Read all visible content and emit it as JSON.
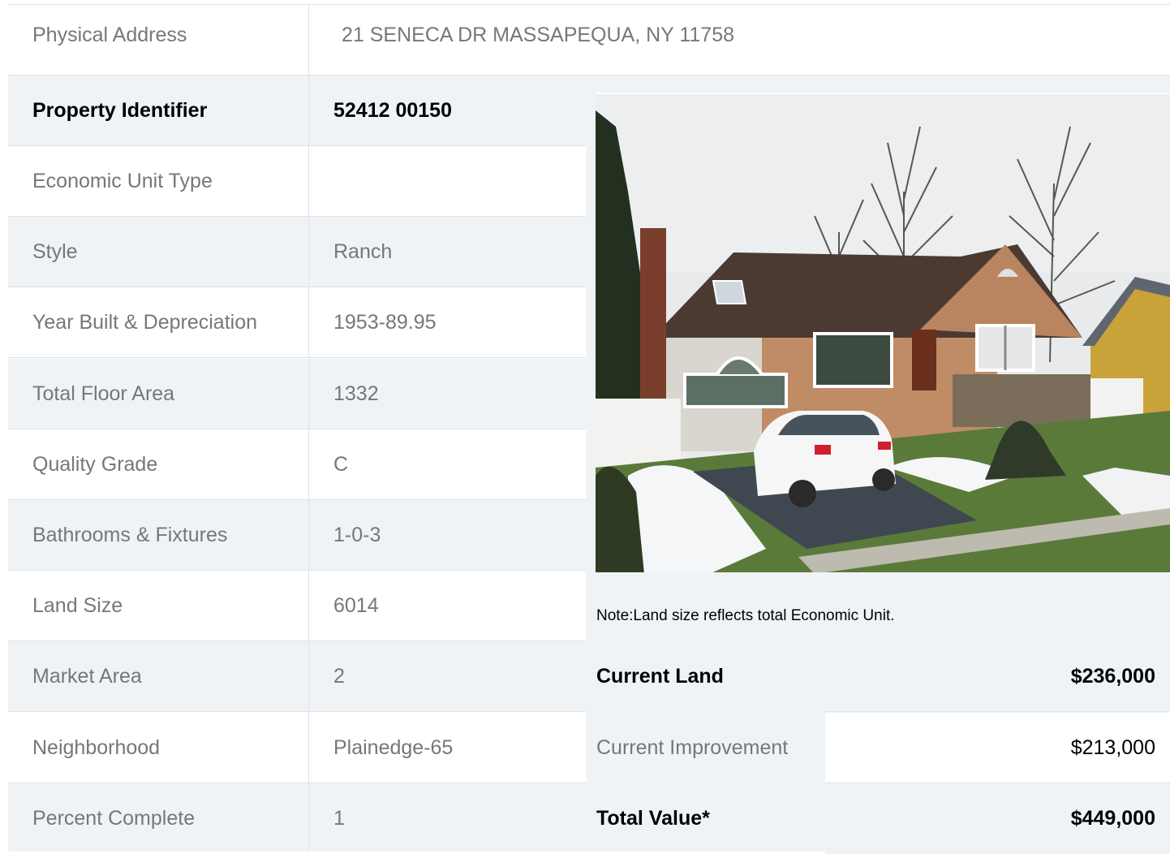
{
  "address": {
    "label": "Physical Address",
    "value": "21  SENECA DR  MASSAPEQUA, NY  11758"
  },
  "details": [
    {
      "label": "Property Identifier",
      "value": "52412  00150",
      "emphasis": true
    },
    {
      "label": "Economic Unit Type",
      "value": ""
    },
    {
      "label": "Style",
      "value": "Ranch"
    },
    {
      "label": "Year Built & Depreciation",
      "value": "1953-89.95"
    },
    {
      "label": "Total Floor Area",
      "value": "1332"
    },
    {
      "label": "Quality Grade",
      "value": "C"
    },
    {
      "label": "Bathrooms & Fixtures",
      "value": "1-0-3"
    },
    {
      "label": "Land Size",
      "value": "6014"
    },
    {
      "label": "Market Area",
      "value": "2"
    },
    {
      "label": "Neighborhood",
      "value": "Plainedge-65"
    },
    {
      "label": "Percent Complete",
      "value": "1"
    }
  ],
  "note": "Note:Land size reflects total Economic Unit.",
  "valuation": [
    {
      "label": "Current Land",
      "amount": "$236,000",
      "emphasis": true
    },
    {
      "label": "Current Improvement",
      "amount": "$213,000"
    },
    {
      "label": "Total Value*",
      "amount": "$449,000",
      "emphasis": true
    }
  ],
  "colors": {
    "text_muted": "#777777",
    "text_strong": "#000000",
    "row_alt": "#f0f3f6",
    "border": "#dee2e6"
  }
}
